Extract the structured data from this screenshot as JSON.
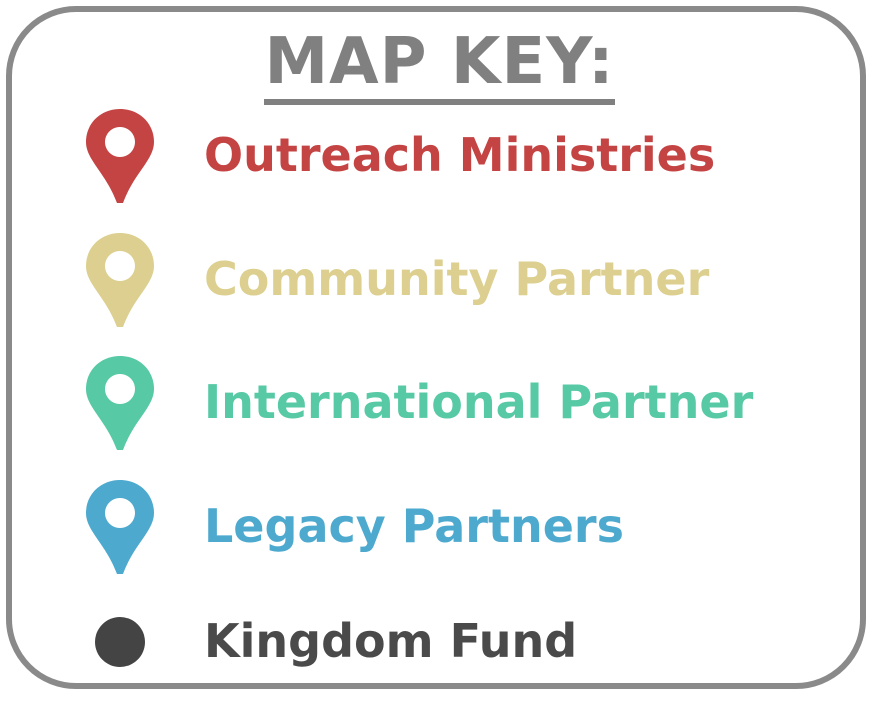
{
  "title": "MAP KEY:",
  "legend": [
    {
      "label": "Outreach Ministries",
      "color": "#c44444",
      "icon": "map-pin-icon"
    },
    {
      "label": "Community Partner",
      "color": "#dccf8f",
      "icon": "map-pin-icon"
    },
    {
      "label": "International Partner",
      "color": "#57c9a4",
      "icon": "map-pin-icon"
    },
    {
      "label": "Legacy Partners",
      "color": "#4ea9cf",
      "icon": "map-pin-icon"
    },
    {
      "label": "Kingdom Fund",
      "color": "#444444",
      "icon": "dot-icon"
    }
  ]
}
